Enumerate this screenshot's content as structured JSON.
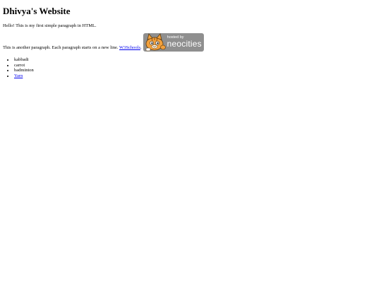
{
  "page": {
    "title": "Dhivya's Website",
    "paragraph1": "Hello! This is my first simple paragraph in HTML.",
    "paragraph2_text": "This is another paragraph. Each paragraph starts on a new line.",
    "paragraph2_link": "W3Schools",
    "paragraph2_after_link": ".",
    "badge": {
      "hosted_text": "hosted by",
      "brand_text": "neocities",
      "background": "#8f8f8f",
      "cat_color": "#f2a03c"
    },
    "list": [
      "kabbadi",
      "carrot",
      "badminton"
    ],
    "list_link": "Yarn",
    "link_color": "#0000ee"
  }
}
